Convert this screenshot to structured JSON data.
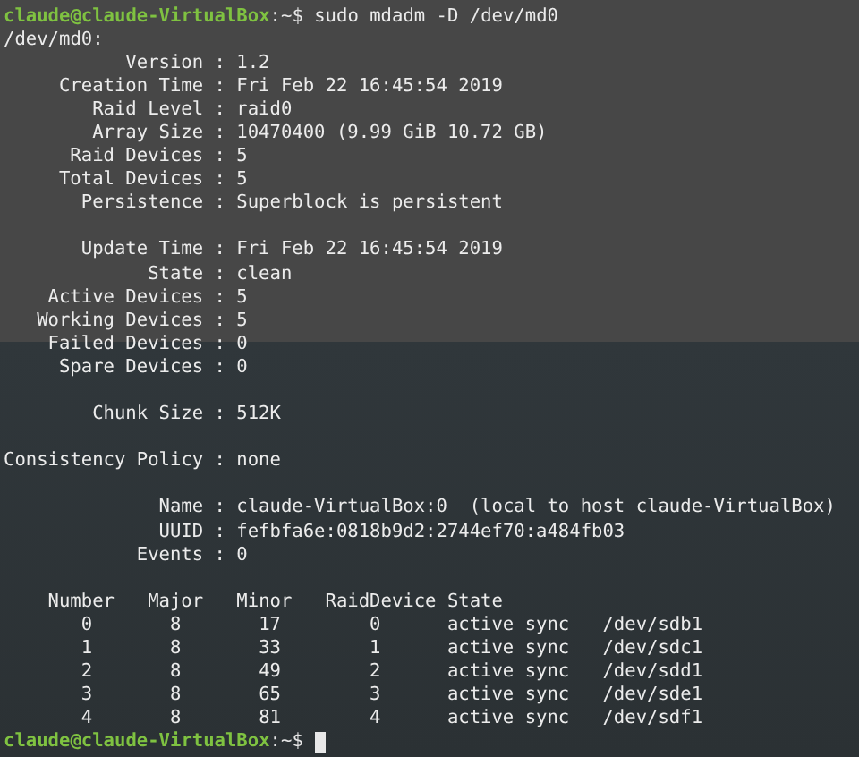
{
  "terminal": {
    "lines": [
      {
        "kind": "prompt",
        "user_host": "claude@claude-VirtualBox",
        "prompt_end": ":~$",
        "command": "sudo mdadm -D /dev/md0"
      },
      {
        "kind": "text",
        "text": "/dev/md0:"
      },
      {
        "kind": "field",
        "label": "Version",
        "separator": ":",
        "value": "1.2"
      },
      {
        "kind": "field",
        "label": "Creation Time",
        "separator": ":",
        "value": "Fri Feb 22 16:45:54 2019"
      },
      {
        "kind": "field",
        "label": "Raid Level",
        "separator": ":",
        "value": "raid0"
      },
      {
        "kind": "field",
        "label": "Array Size",
        "separator": ":",
        "value": "10470400 (9.99 GiB 10.72 GB)"
      },
      {
        "kind": "field",
        "label": "Raid Devices",
        "separator": ":",
        "value": "5"
      },
      {
        "kind": "field",
        "label": "Total Devices",
        "separator": ":",
        "value": "5"
      },
      {
        "kind": "field",
        "label": "Persistence",
        "separator": ":",
        "value": "Superblock is persistent"
      },
      {
        "kind": "blank"
      },
      {
        "kind": "field",
        "label": "Update Time",
        "separator": ":",
        "value": "Fri Feb 22 16:45:54 2019"
      },
      {
        "kind": "field",
        "label": "State",
        "separator": ":",
        "value": "clean"
      },
      {
        "kind": "field",
        "label": "Active Devices",
        "separator": ":",
        "value": "5"
      },
      {
        "kind": "field",
        "label": "Working Devices",
        "separator": ":",
        "value": "5"
      },
      {
        "kind": "field",
        "label": "Failed Devices",
        "separator": ":",
        "value": "0"
      },
      {
        "kind": "field",
        "label": "Spare Devices",
        "separator": ":",
        "value": "0"
      },
      {
        "kind": "blank"
      },
      {
        "kind": "field",
        "label": "Chunk Size",
        "separator": ":",
        "value": "512K"
      },
      {
        "kind": "blank"
      },
      {
        "kind": "field",
        "label": "Consistency Policy",
        "separator": ":",
        "value": "none"
      },
      {
        "kind": "blank"
      },
      {
        "kind": "field",
        "label": "Name",
        "separator": ":",
        "value": "claude-VirtualBox:0  (local to host claude-VirtualBox)"
      },
      {
        "kind": "field",
        "label": "UUID",
        "separator": ":",
        "value": "fefbfa6e:0818b9d2:2744ef70:a484fb03"
      },
      {
        "kind": "field",
        "label": "Events",
        "separator": ":",
        "value": "0"
      },
      {
        "kind": "blank"
      },
      {
        "kind": "table_header",
        "cells": [
          "Number",
          "Major",
          "Minor",
          "RaidDevice",
          "State"
        ]
      },
      {
        "kind": "table_row",
        "cells": [
          "0",
          "8",
          "17",
          "0",
          "active sync",
          "/dev/sdb1"
        ]
      },
      {
        "kind": "table_row",
        "cells": [
          "1",
          "8",
          "33",
          "1",
          "active sync",
          "/dev/sdc1"
        ]
      },
      {
        "kind": "table_row",
        "cells": [
          "2",
          "8",
          "49",
          "2",
          "active sync",
          "/dev/sdd1"
        ]
      },
      {
        "kind": "table_row",
        "cells": [
          "3",
          "8",
          "65",
          "3",
          "active sync",
          "/dev/sde1"
        ]
      },
      {
        "kind": "table_row",
        "cells": [
          "4",
          "8",
          "81",
          "4",
          "active sync",
          "/dev/sdf1"
        ]
      },
      {
        "kind": "prompt",
        "user_host": "claude@claude-VirtualBox",
        "prompt_end": ":~$",
        "cursor": true
      }
    ]
  }
}
